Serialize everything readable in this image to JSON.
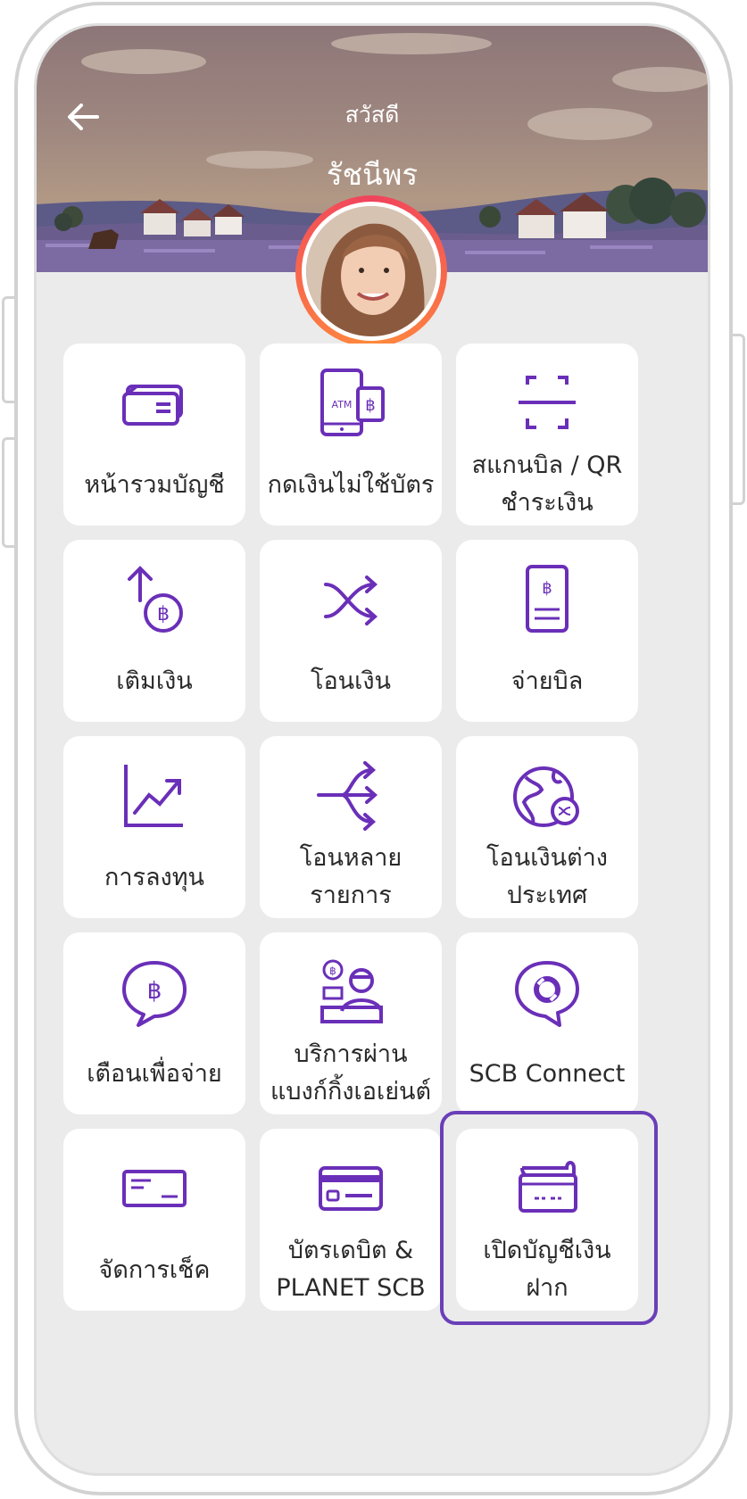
{
  "header": {
    "greeting": "สวัสดี",
    "user_name": "รัชนีพร"
  },
  "colors": {
    "accent": "#6a2fb8",
    "highlight_border": "#6a3fb8",
    "background": "#ebebeb"
  },
  "menu": [
    {
      "icon": "account-summary-icon",
      "lines": [
        "หน้ารวมบัญชี"
      ]
    },
    {
      "icon": "cardless-atm-icon",
      "lines": [
        "กดเงินไม่ใช้บัตร"
      ]
    },
    {
      "icon": "scan-qr-icon",
      "lines": [
        "สแกนบิล / QR",
        "ชำระเงิน"
      ]
    },
    {
      "icon": "top-up-icon",
      "lines": [
        "เติมเงิน"
      ]
    },
    {
      "icon": "transfer-icon",
      "lines": [
        "โอนเงิน"
      ]
    },
    {
      "icon": "bill-payment-icon",
      "lines": [
        "จ่ายบิล"
      ]
    },
    {
      "icon": "investment-icon",
      "lines": [
        "การลงทุน"
      ]
    },
    {
      "icon": "bulk-transfer-icon",
      "lines": [
        "โอนหลาย",
        "รายการ"
      ]
    },
    {
      "icon": "international-transfer-icon",
      "lines": [
        "โอนเงินต่าง",
        "ประเทศ"
      ]
    },
    {
      "icon": "payment-alert-icon",
      "lines": [
        "เตือนเพื่อจ่าย"
      ]
    },
    {
      "icon": "banking-agent-icon",
      "lines": [
        "บริการผ่าน",
        "แบงก์กิ้งเอเย่นต์"
      ]
    },
    {
      "icon": "scb-connect-icon",
      "lines": [
        "SCB Connect"
      ]
    },
    {
      "icon": "cheque-icon",
      "lines": [
        "จัดการเช็ค"
      ]
    },
    {
      "icon": "debit-card-icon",
      "lines": [
        "บัตรเดบิต &",
        "PLANET SCB"
      ]
    },
    {
      "icon": "open-account-icon",
      "lines": [
        "เปิดบัญชีเงิน",
        "ฝาก"
      ]
    }
  ],
  "highlighted_item": "เปิดบัญชีเงินฝาก"
}
